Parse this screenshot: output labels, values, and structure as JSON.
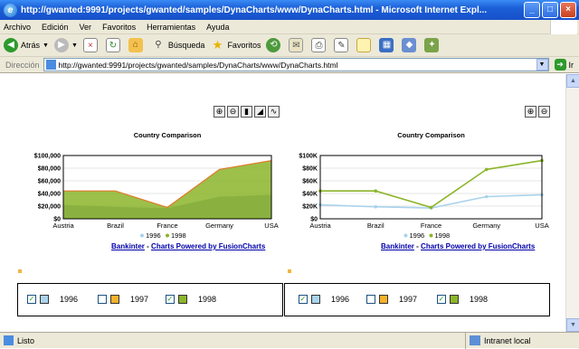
{
  "window": {
    "title": "http://gwanted:9991/projects/gwanted/samples/DynaCharts/www/DynaCharts.html - Microsoft Internet Expl...",
    "buttons": [
      "_",
      "□",
      "×"
    ]
  },
  "menu": [
    "Archivo",
    "Edición",
    "Ver",
    "Favoritos",
    "Herramientas",
    "Ayuda"
  ],
  "toolbar": {
    "back": "Atrás",
    "search": "Búsqueda",
    "favorites": "Favoritos"
  },
  "address": {
    "label": "Dirección",
    "url": "http://gwanted:9991/projects/gwanted/samples/DynaCharts/www/DynaCharts.html",
    "go": "Ir"
  },
  "status": {
    "left": "Listo",
    "zone": "Intranet local"
  },
  "colors": {
    "s1996": "#a9d3ec",
    "s1997": "#f5b12a",
    "s1998": "#8bb52a"
  },
  "footer": {
    "bank": "Bankinter",
    "sep": "-",
    "powered": "Charts Powered by FusionCharts"
  },
  "legend": [
    "1996",
    "1997",
    "1998"
  ],
  "chart_data": [
    {
      "type": "area",
      "title": "Country Comparison",
      "categories": [
        "Austria",
        "Brazil",
        "France",
        "Germany",
        "USA"
      ],
      "yticks": [
        "$100,000",
        "$80,000",
        "$60,000",
        "$40,000",
        "$20,000",
        "$0"
      ],
      "ylim": [
        0,
        100000
      ],
      "series": [
        {
          "name": "1996",
          "values": [
            22000,
            19000,
            17000,
            35000,
            38000
          ]
        },
        {
          "name": "1998",
          "values": [
            44000,
            44000,
            18000,
            78000,
            92000
          ]
        }
      ],
      "legend": [
        "1996",
        "1998"
      ]
    },
    {
      "type": "line",
      "title": "Country Comparison",
      "categories": [
        "Austria",
        "Brazil",
        "France",
        "Germany",
        "USA"
      ],
      "yticks": [
        "$100K",
        "$80K",
        "$60K",
        "$40K",
        "$20K",
        "$0"
      ],
      "ylim": [
        0,
        100000
      ],
      "series": [
        {
          "name": "1996",
          "values": [
            22000,
            19000,
            17000,
            35000,
            38000
          ]
        },
        {
          "name": "1998",
          "values": [
            44000,
            44000,
            18000,
            78000,
            92000
          ]
        }
      ],
      "legend": [
        "1996",
        "1998"
      ]
    }
  ]
}
